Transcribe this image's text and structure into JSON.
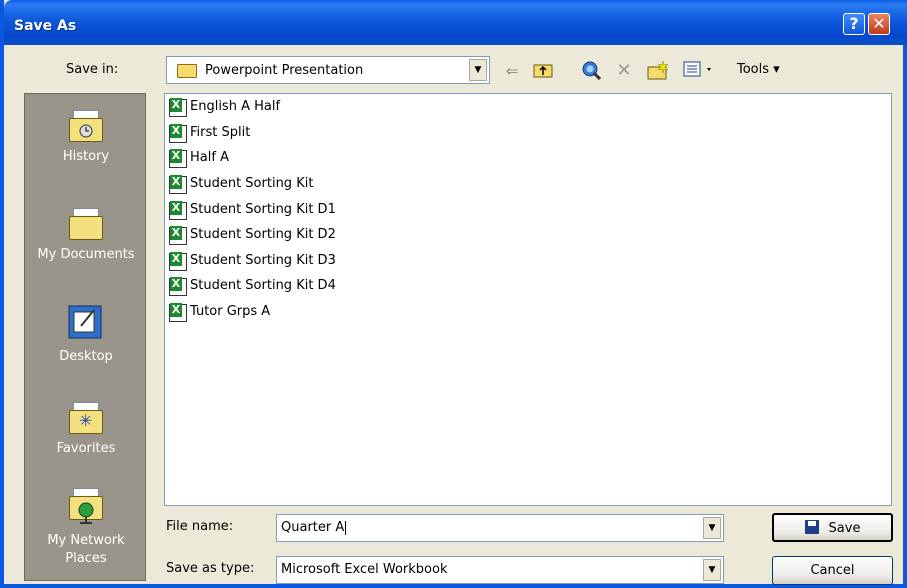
{
  "window": {
    "title": "Save As",
    "help_glyph": "?",
    "close_glyph": "✕"
  },
  "toolbar": {
    "save_in_label": "Save in:",
    "save_in_value": "Powerpoint Presentation",
    "tools_label": "Tools ▾",
    "icons": [
      "back-arrow-icon",
      "up-folder-icon",
      "search-web-icon",
      "delete-icon",
      "new-folder-icon",
      "views-icon"
    ]
  },
  "places": [
    {
      "label": "History",
      "icon": "history-folder-icon"
    },
    {
      "label": "My Documents",
      "icon": "my-documents-folder-icon"
    },
    {
      "label": "Desktop",
      "icon": "desktop-icon"
    },
    {
      "label": "Favorites",
      "icon": "favorites-folder-icon"
    },
    {
      "label": "My Network Places",
      "icon": "network-places-icon"
    }
  ],
  "files": [
    "English A Half",
    "First Split",
    "Half A",
    "Student Sorting Kit",
    "Student Sorting Kit D1",
    "Student Sorting Kit D2",
    "Student Sorting Kit D3",
    "Student Sorting Kit D4",
    "Tutor Grps A"
  ],
  "form": {
    "file_name_label": "File name:",
    "file_name_value": "Quarter A",
    "save_as_type_label": "Save as type:",
    "save_as_type_value": "Microsoft Excel Workbook"
  },
  "buttons": {
    "save": "Save",
    "cancel": "Cancel"
  },
  "colors": {
    "title_bar": "#0A5FE6",
    "places_bar": "#9A958A",
    "excel_green": "#1C8A2F"
  }
}
